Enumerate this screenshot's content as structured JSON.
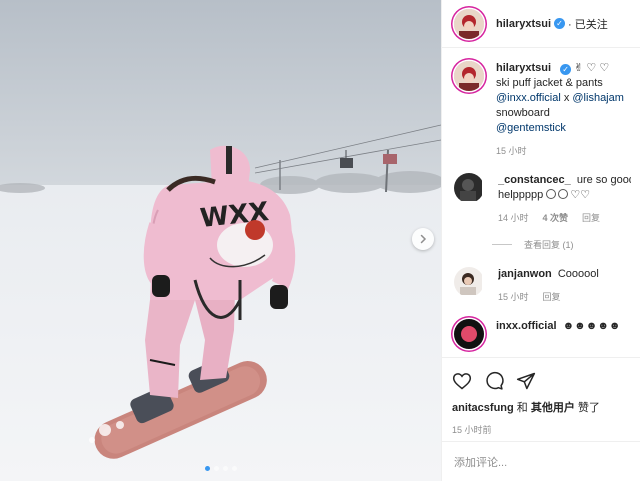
{
  "post": {
    "author": "hilaryxtsui",
    "follow_status": "· 已关注",
    "caption_line1": "ski puff jacket & pants",
    "caption_mention1": "@inxx.official",
    "caption_x": " x ",
    "caption_mention2": "@lishajam",
    "caption_line3": "snowboard",
    "caption_mention3": "@gentemstick",
    "caption_time": "15 小时"
  },
  "comments": [
    {
      "user": "_constancec_",
      "text": "ure so good n",
      "text2": "helppppp",
      "time": "14 小时",
      "likes": "4 次赞",
      "reply": "回复"
    },
    {
      "user": "janjanwon",
      "text": "Coooool",
      "time": "15 小时",
      "reply": "回复"
    },
    {
      "user": "inxx.official"
    }
  ],
  "view_replies": "查看回复 (1)",
  "likes_line": {
    "user1": "anitacsfung",
    "conj": " 和 ",
    "others": "其他用户",
    "suffix": " 赞了"
  },
  "post_time": "15 小时前",
  "comment_placeholder": "添加评论...",
  "carousel": {
    "total": 4,
    "current": 1
  },
  "icons": {
    "like": "heart-icon",
    "comment": "comment-icon",
    "share": "paper-plane-icon",
    "next": "chevron-right-icon",
    "verified": "verified-badge-icon"
  },
  "colors": {
    "accent": "#3897f0",
    "link": "#00376b",
    "muted": "#8e8e8e"
  }
}
